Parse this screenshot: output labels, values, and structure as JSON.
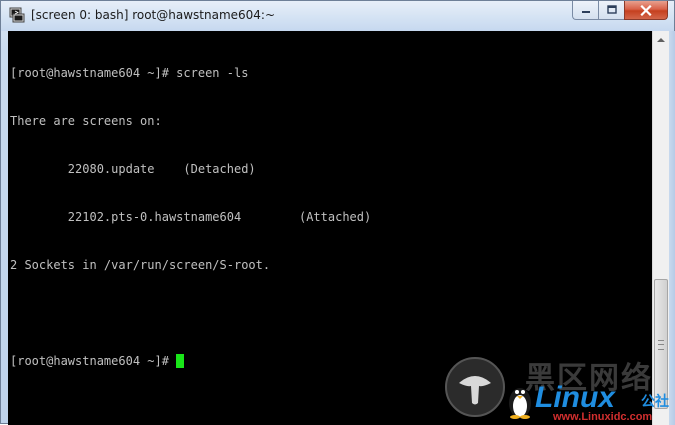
{
  "window": {
    "title": "[screen 0: bash] root@hawstname604:~",
    "icon": "putty-terminal-icon"
  },
  "controls": {
    "minimize": "minimize-icon",
    "maximize": "maximize-icon",
    "close": "close-icon"
  },
  "terminal": {
    "lines": [
      "[root@hawstname604 ~]# screen -ls",
      "There are screens on:",
      "        22080.update    (Detached)",
      "        22102.pts-0.hawstname604        (Attached)",
      "2 Sockets in /var/run/screen/S-root.",
      "",
      "[root@hawstname604 ~]# "
    ],
    "text_color": "#c0c0c0",
    "background": "#000000",
    "cursor_color": "#19e619"
  },
  "watermark": {
    "chinese": "黑区网络",
    "brand": "Linux",
    "suffix": "公社",
    "url": "www.Linuxidc.com"
  }
}
